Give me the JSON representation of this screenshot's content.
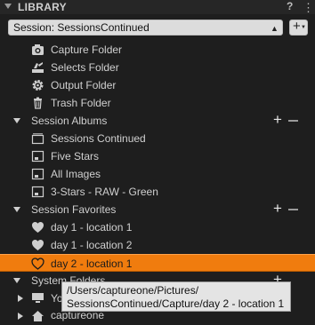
{
  "panel": {
    "title": "LIBRARY",
    "help_label": "?",
    "more_label": "⋮"
  },
  "session": {
    "selected": "Session: SessionsContinued"
  },
  "folders": [
    {
      "label": "Capture Folder",
      "icon": "camera-icon"
    },
    {
      "label": "Selects Folder",
      "icon": "selects-icon"
    },
    {
      "label": "Output Folder",
      "icon": "gear-icon"
    },
    {
      "label": "Trash Folder",
      "icon": "trash-icon"
    }
  ],
  "session_albums": {
    "label": "Session Albums",
    "items": [
      {
        "label": "Sessions Continued"
      },
      {
        "label": "Five Stars"
      },
      {
        "label": "All Images"
      },
      {
        "label": "3-Stars - RAW - Green"
      }
    ]
  },
  "session_favorites": {
    "label": "Session Favorites",
    "items": [
      {
        "label": "day 1 - location 1"
      },
      {
        "label": "day 1 - location 2"
      },
      {
        "label": "day 2 - location 1",
        "selected": true
      }
    ]
  },
  "system_folders": {
    "label": "System Folders",
    "items": [
      {
        "label": "Yo"
      }
    ]
  },
  "bottom_item": {
    "label": "captureone"
  },
  "tooltip": {
    "line1": "/Users/captureone/Pictures/",
    "line2": "SessionsContinued/Capture/day 2 - location 1"
  },
  "colors": {
    "selection": "#f07c0e",
    "background": "#1e1e1e"
  }
}
